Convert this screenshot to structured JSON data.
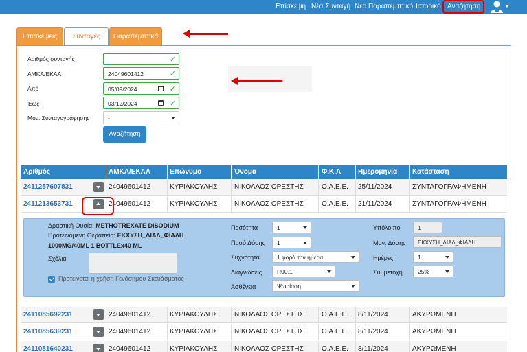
{
  "nav": {
    "items": [
      "Επίσκεψη",
      "Νέα Συνταγή",
      "Νέο Παραπεμπτικό",
      "Ιστορικό",
      "Αναζήτηση"
    ],
    "active": "Αναζήτηση"
  },
  "tabs": [
    "Επισκέψεις",
    "Συνταγές",
    "Παραπεμπτικά"
  ],
  "form": {
    "labels": {
      "prescription_number": "Αριθμός συνταγής",
      "amka": "ΑΜΚΑ/ΕΚΑΑ",
      "from": "Από",
      "to": "Έως",
      "mono": "Μον. Συνταγογράφησης"
    },
    "values": {
      "prescription_number": "",
      "amka": "24049601412",
      "from": "05/09/2024",
      "to": "03/12/2024",
      "mono": "-"
    },
    "search_button": "Αναζήτηση"
  },
  "table": {
    "headers": [
      "Αριθμός",
      "ΑΜΚΑ/ΕΚΑΑ",
      "Επώνυμο",
      "Όνομα",
      "Φ.Κ.Α",
      "Ημερομηνία",
      "Κατάσταση"
    ],
    "rows": [
      {
        "number": "2411257607831",
        "amka": "24049601412",
        "surname": "ΚΥΡΙΑΚΟΥΛΗΣ",
        "name": "ΝΙΚΟΛΑΟΣ ΟΡΕΣΤΗΣ",
        "fka": "Ο.Α.Ε.Ε.",
        "date": "25/11/2024",
        "status": "ΣΥΝΤΑΓΟΓΡΑΦΗΜΕΝΗ"
      },
      {
        "number": "2411213653731",
        "amka": "24049601412",
        "surname": "ΚΥΡΙΑΚΟΥΛΗΣ",
        "name": "ΝΙΚΟΛΑΟΣ ΟΡΕΣΤΗΣ",
        "fka": "Ο.Α.Ε.Ε.",
        "date": "21/11/2024",
        "status": "ΣΥΝΤΑΓΟΓΡΑΦΗΜΕΝΗ"
      },
      {
        "number": "2411085692231",
        "amka": "24049601412",
        "surname": "ΚΥΡΙΑΚΟΥΛΗΣ",
        "name": "ΝΙΚΟΛΑΟΣ ΟΡΕΣΤΗΣ",
        "fka": "Ο.Α.Ε.Ε.",
        "date": "8/11/2024",
        "status": "ΑΚΥΡΩΜΕΝΗ"
      },
      {
        "number": "2411085639231",
        "amka": "24049601412",
        "surname": "ΚΥΡΙΑΚΟΥΛΗΣ",
        "name": "ΝΙΚΟΛΑΟΣ ΟΡΕΣΤΗΣ",
        "fka": "Ο.Α.Ε.Ε.",
        "date": "8/11/2024",
        "status": "ΑΚΥΡΩΜΕΝΗ"
      },
      {
        "number": "2411081640231",
        "amka": "24049601412",
        "surname": "ΚΥΡΙΑΚΟΥΛΗΣ",
        "name": "ΝΙΚΟΛΑΟΣ ΟΡΕΣΤΗΣ",
        "fka": "Ο.Α.Ε.Ε.",
        "date": "8/11/2024",
        "status": "ΑΚΥΡΩΜΕΝΗ"
      }
    ]
  },
  "detail": {
    "active_substance_label": "Δραστική Ουσία:",
    "active_substance": "METHOTREXATE DISODIUM",
    "therapy_label": "Προτεινόμενη Θεραπεία:",
    "therapy_line1": "ΕΚΧΥΣΗ_ΔΙΑΛ_ΦΙΑΛΗ",
    "therapy_line2": "1000MG/40ML 1 BOTTLEx40 ML",
    "comments_label": "Σχόλια",
    "generic_label": "Προτείνεται η χρήση Γενόσημου Σκευάσματος",
    "quantity_label": "Ποσότητα",
    "quantity": "1",
    "dose_label": "Ποσό Δόσης",
    "dose": "1",
    "frequency_label": "Συχνότητα",
    "frequency": "1 φορά την ημέρα",
    "diagnosis_label": "Διαγνώσεις",
    "diagnosis": "R00.1",
    "disease_label": "Ασθένεια",
    "disease": "Ψωρίαση",
    "remaining_label": "Υπόλοιπο",
    "remaining": "1",
    "dose_unit_label": "Μον. Δόσης",
    "dose_unit": "ΕΚΧΥΣΗ_ΔΙΑΛ_ΦΙΑΛΗ",
    "days_label": "Ημέρες",
    "days": "1",
    "copay_label": "Συμμετοχή",
    "copay": "25%"
  },
  "icons": {
    "user": "user-avatar-icon",
    "toggle_down": "chevron-down-icon",
    "toggle_up": "chevron-up-icon",
    "check": "checkmark-icon",
    "calendar": "calendar-icon"
  },
  "colors": {
    "primary": "#2e86c9",
    "orange": "#f29a3e",
    "annotation_red": "#e10000",
    "valid_green": "#3aa845"
  }
}
